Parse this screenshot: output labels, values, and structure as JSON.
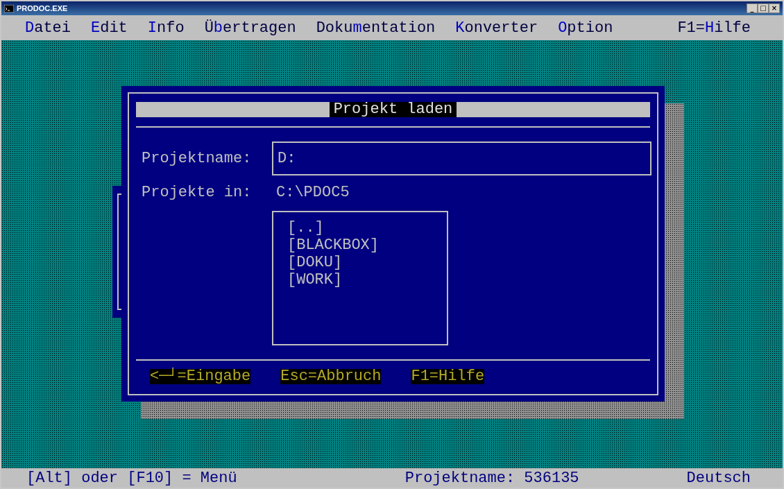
{
  "window": {
    "title": "PRODOC.EXE",
    "controls": [
      "_",
      "□",
      "×"
    ]
  },
  "menu": [
    {
      "key": "D",
      "after": "atei"
    },
    {
      "key": "E",
      "after": "dit"
    },
    {
      "key": "I",
      "after": "nfo"
    },
    {
      "before": "Ü",
      "key": "b",
      "after": "ertragen"
    },
    {
      "before": "Doku",
      "key": "m",
      "after": "entation"
    },
    {
      "key": "K",
      "after": "onverter"
    },
    {
      "key": "O",
      "after": "ption"
    },
    {
      "before": "F1=",
      "key": "H",
      "after": "ilfe"
    }
  ],
  "dialog": {
    "title": "Projekt laden",
    "name_label": "Projektname:",
    "name_value": "D:",
    "folder_label": "Projekte in:",
    "folder_value": "C:\\PDOC5",
    "items": [
      {
        "label": "[..]"
      },
      {
        "label": "[BLACKBOX]"
      },
      {
        "label": "[DOKU]"
      },
      {
        "label": "[WORK]"
      }
    ],
    "keys": [
      "<─┘=Eingabe",
      "Esc=Abbruch",
      "F1=Hilfe"
    ]
  },
  "status_bar": {
    "left": "[Alt] oder [F10] = Menü",
    "center": "Projektname: 536135",
    "right": "Deutsch"
  }
}
